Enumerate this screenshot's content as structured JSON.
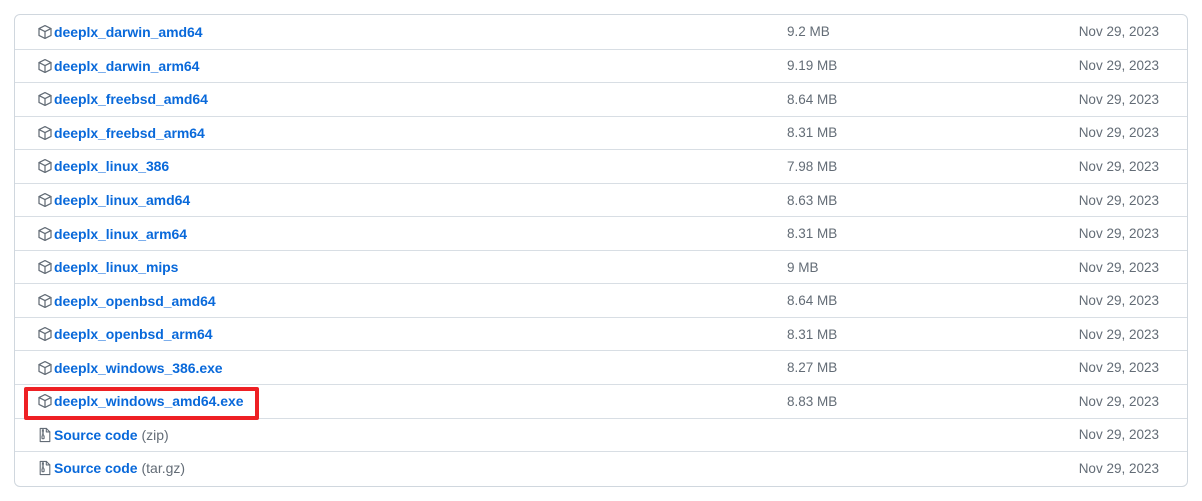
{
  "panel": {
    "name": "release-assets-list",
    "border_color": "#d0d7de",
    "row_divider_color": "#d8dee4",
    "link_color": "#0969da",
    "muted_text_color": "#636c76"
  },
  "annotation": {
    "type": "rectangle-highlight",
    "color": "#ee2024",
    "target_row_index": 11,
    "target_label": "deeplx_windows_amd64.exe"
  },
  "assets": [
    {
      "icon": "package-icon",
      "name": "deeplx_darwin_amd64",
      "suffix": "",
      "size": "9.2 MB",
      "date": "Nov 29, 2023"
    },
    {
      "icon": "package-icon",
      "name": "deeplx_darwin_arm64",
      "suffix": "",
      "size": "9.19 MB",
      "date": "Nov 29, 2023"
    },
    {
      "icon": "package-icon",
      "name": "deeplx_freebsd_amd64",
      "suffix": "",
      "size": "8.64 MB",
      "date": "Nov 29, 2023"
    },
    {
      "icon": "package-icon",
      "name": "deeplx_freebsd_arm64",
      "suffix": "",
      "size": "8.31 MB",
      "date": "Nov 29, 2023"
    },
    {
      "icon": "package-icon",
      "name": "deeplx_linux_386",
      "suffix": "",
      "size": "7.98 MB",
      "date": "Nov 29, 2023"
    },
    {
      "icon": "package-icon",
      "name": "deeplx_linux_amd64",
      "suffix": "",
      "size": "8.63 MB",
      "date": "Nov 29, 2023"
    },
    {
      "icon": "package-icon",
      "name": "deeplx_linux_arm64",
      "suffix": "",
      "size": "8.31 MB",
      "date": "Nov 29, 2023"
    },
    {
      "icon": "package-icon",
      "name": "deeplx_linux_mips",
      "suffix": "",
      "size": "9 MB",
      "date": "Nov 29, 2023"
    },
    {
      "icon": "package-icon",
      "name": "deeplx_openbsd_amd64",
      "suffix": "",
      "size": "8.64 MB",
      "date": "Nov 29, 2023"
    },
    {
      "icon": "package-icon",
      "name": "deeplx_openbsd_arm64",
      "suffix": "",
      "size": "8.31 MB",
      "date": "Nov 29, 2023"
    },
    {
      "icon": "package-icon",
      "name": "deeplx_windows_386.exe",
      "suffix": "",
      "size": "8.27 MB",
      "date": "Nov 29, 2023"
    },
    {
      "icon": "package-icon",
      "name": "deeplx_windows_amd64.exe",
      "suffix": "",
      "size": "8.83 MB",
      "date": "Nov 29, 2023"
    },
    {
      "icon": "file-zip-icon",
      "name": "Source code",
      "suffix": "(zip)",
      "size": "",
      "date": "Nov 29, 2023"
    },
    {
      "icon": "file-zip-icon",
      "name": "Source code",
      "suffix": "(tar.gz)",
      "size": "",
      "date": "Nov 29, 2023"
    }
  ]
}
